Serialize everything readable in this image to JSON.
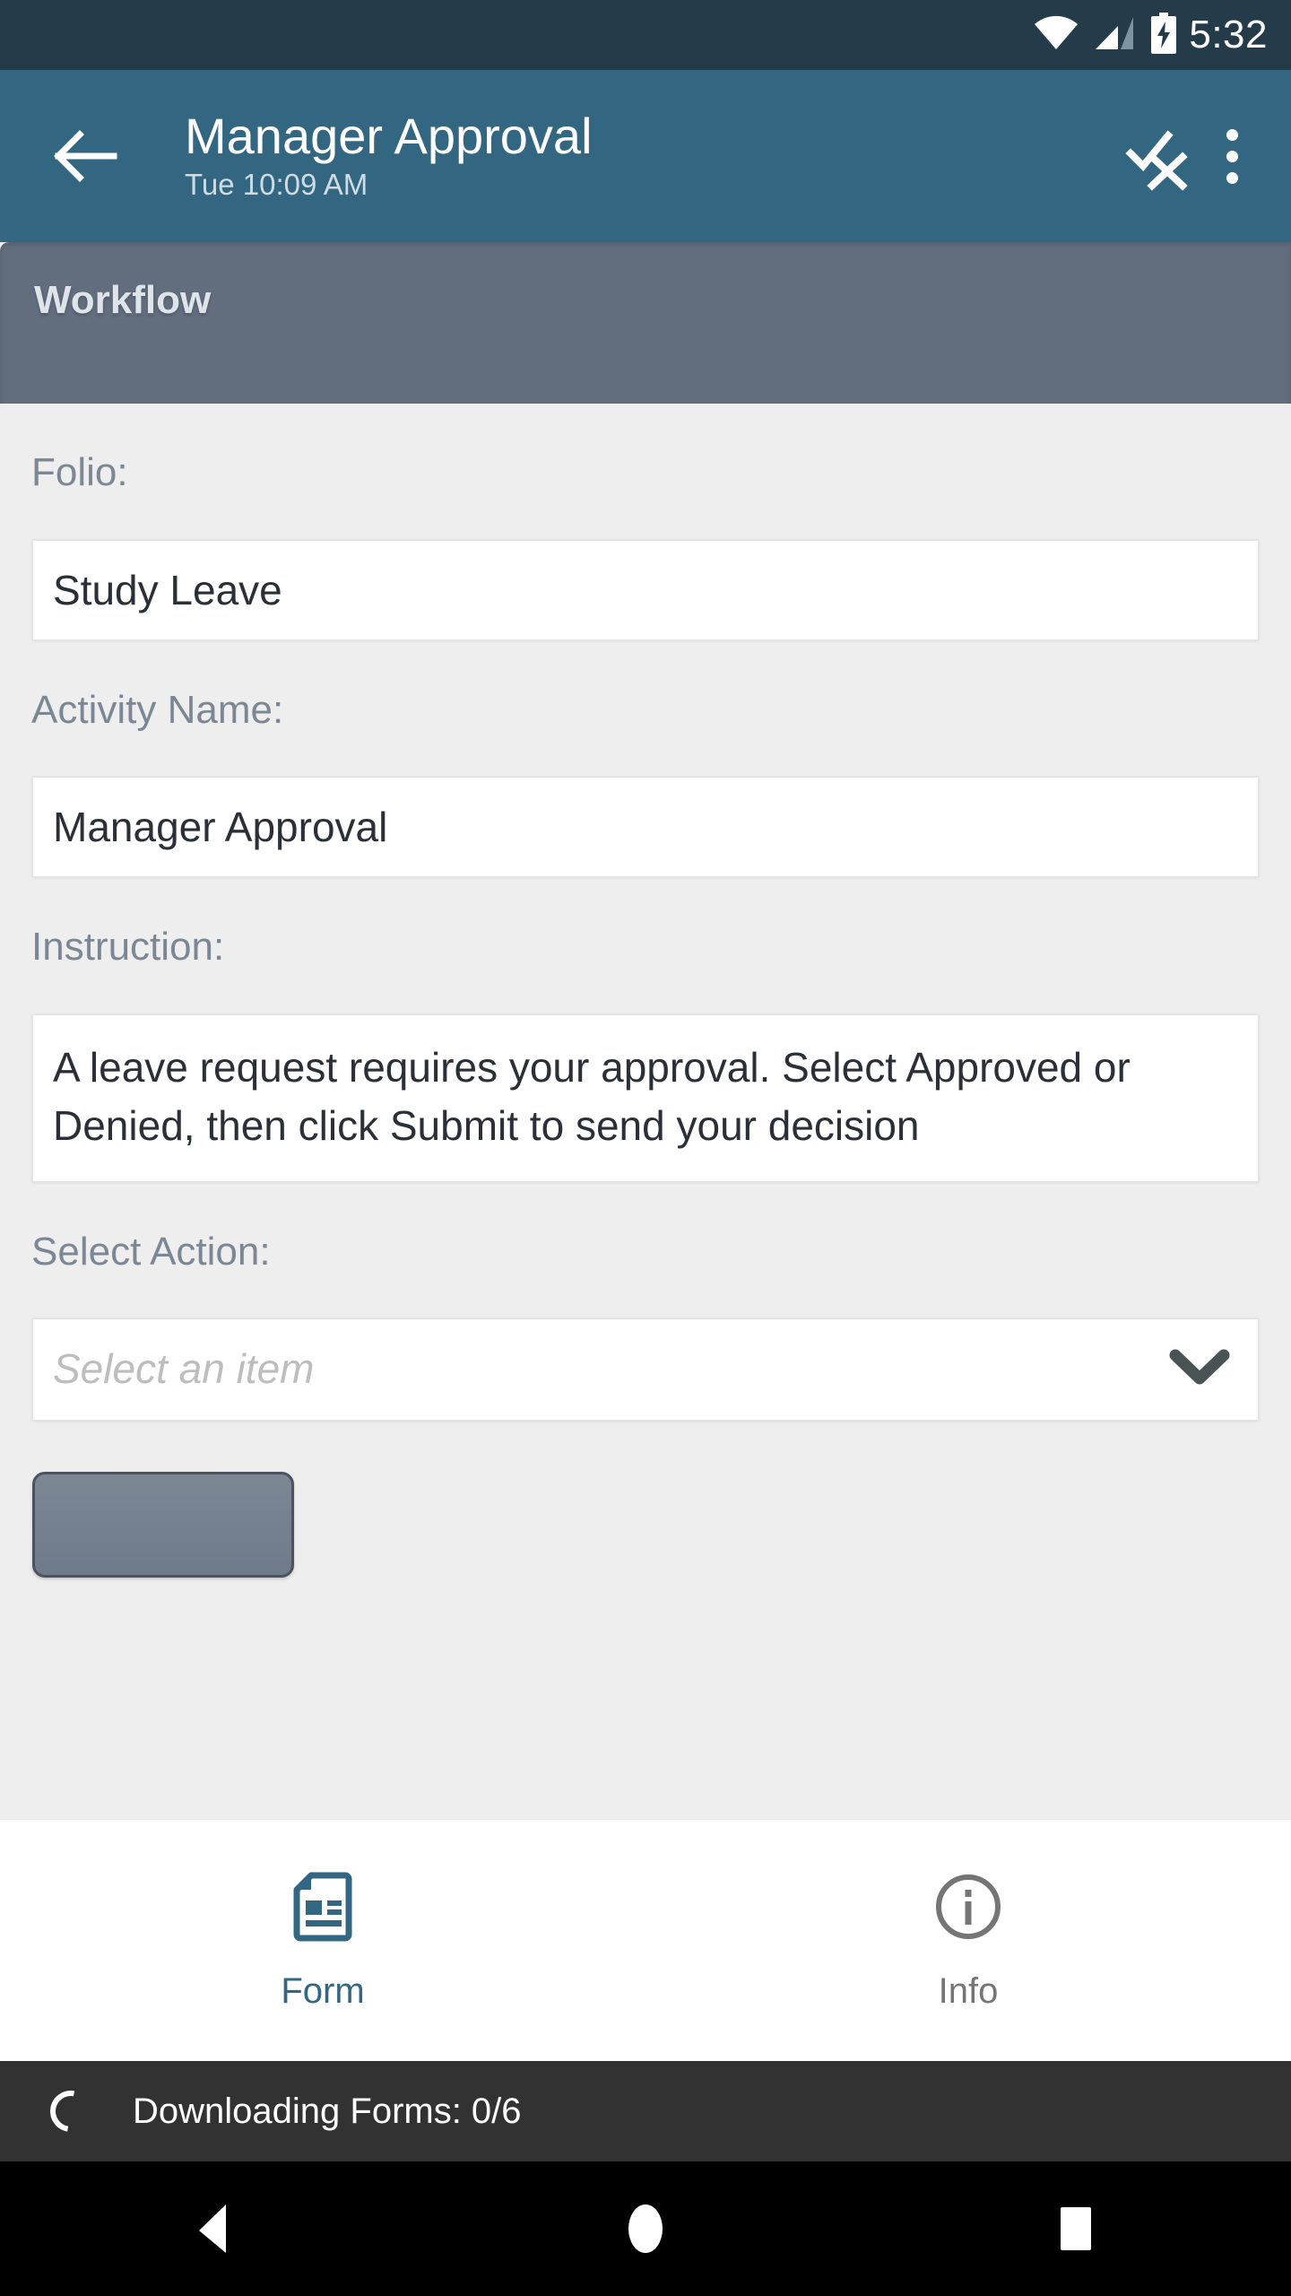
{
  "status_bar": {
    "time": "5:32",
    "icons": [
      "wifi-icon",
      "cellular-signal-icon",
      "battery-charging-icon"
    ],
    "background_color": "#243b4a"
  },
  "app_bar": {
    "background_color": "#336781",
    "back_icon": "back-arrow-icon",
    "title": "Manager Approval",
    "subtitle": "Tue 10:09 AM",
    "action_icon": "approve-deny-check-x-icon",
    "overflow_icon": "more-vertical-icon"
  },
  "section": {
    "label": "Workflow",
    "background_color": "#626e7e"
  },
  "form": {
    "fields": [
      {
        "label": "Folio:",
        "value": "Study Leave",
        "type": "text"
      },
      {
        "label": "Activity Name:",
        "value": "Manager Approval",
        "type": "text"
      },
      {
        "label": "Instruction:",
        "value": "A leave request requires your approval. Select Approved or Denied, then click Submit to send your decision",
        "type": "textarea"
      },
      {
        "label": "Select Action:",
        "value": "",
        "placeholder": "Select an item",
        "type": "select",
        "chevron_icon": "chevron-down-icon"
      }
    ],
    "submit_button": {
      "label": "",
      "color": "#6f7b8a"
    }
  },
  "tab_bar": {
    "tabs": [
      {
        "label": "Form",
        "icon": "document-form-icon",
        "active": true,
        "color": "#336781"
      },
      {
        "label": "Info",
        "icon": "info-circle-icon",
        "active": false,
        "color": "#757575"
      }
    ]
  },
  "snackbar": {
    "text": "Downloading Forms: 0/6",
    "spinner_icon": "loading-spinner-icon",
    "background_color": "#323232"
  },
  "nav_bar": {
    "buttons": [
      {
        "name": "back",
        "icon": "nav-back-triangle-icon"
      },
      {
        "name": "home",
        "icon": "nav-home-circle-icon"
      },
      {
        "name": "recents",
        "icon": "nav-recents-square-icon"
      }
    ]
  }
}
